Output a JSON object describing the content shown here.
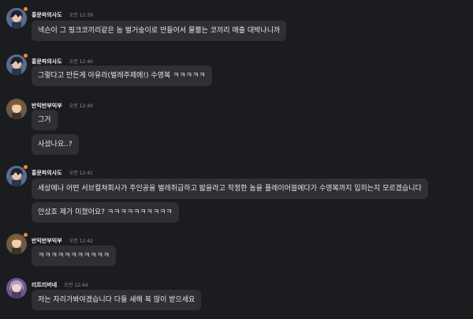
{
  "colors": {
    "background": "#1b1c1f",
    "bubble": "#2e3034",
    "status_dot": "#f28a2e",
    "timestamp": "#8d8f95"
  },
  "messages": [
    {
      "username": "홍문파의사도",
      "time": "오전 12:39",
      "avatar": "avatar-dark-hair-character",
      "bubbles": [
        "넥슨이 그 핑크코끼리같은 놈 벌거숭이로 만들어서 물뿜는 코끼리 매출 대박나니까"
      ]
    },
    {
      "username": "홍문파의사도",
      "time": "오전 12:40",
      "avatar": "avatar-dark-hair-character",
      "bubbles": [
        "그렇다고 만든게 아유라(벌레주제에!) 수영복 ㅋㅋㅋㅋㅋ"
      ]
    },
    {
      "username": "반익반부익부",
      "time": "오전 12:40",
      "avatar": "avatar-brown-hair-character",
      "bubbles": [
        "그거",
        "사셨나요..?"
      ]
    },
    {
      "username": "홍문파의사도",
      "time": "오전 12:41",
      "avatar": "avatar-dark-hair-character",
      "bubbles": [
        "세상에나 어떤 서브컬쳐회사가 주인공을 벌레취급하고 밟을라고 작정한 놈을 플레이어블에다가 수영복까지 입히는지 모르겠습니다",
        "안샀죠 제가 미쳤어요? ㅋㅋㅋㅋㅋㅋㅋㅋㅋㅋ"
      ]
    },
    {
      "username": "반익반부익부",
      "time": "오전 12:42",
      "avatar": "avatar-brown-hair-character",
      "bubbles": [
        "ㅋㅋㅋㅋㅋㅋㅋㅋㅋㅋㅋ"
      ]
    },
    {
      "username": "리트리버네",
      "time": "오전 12:44",
      "avatar": "avatar-purple-hair-character",
      "bubbles": [
        "저는 자리가봐야겠습니다 다들 새해 복 많이 받으세요"
      ]
    }
  ]
}
